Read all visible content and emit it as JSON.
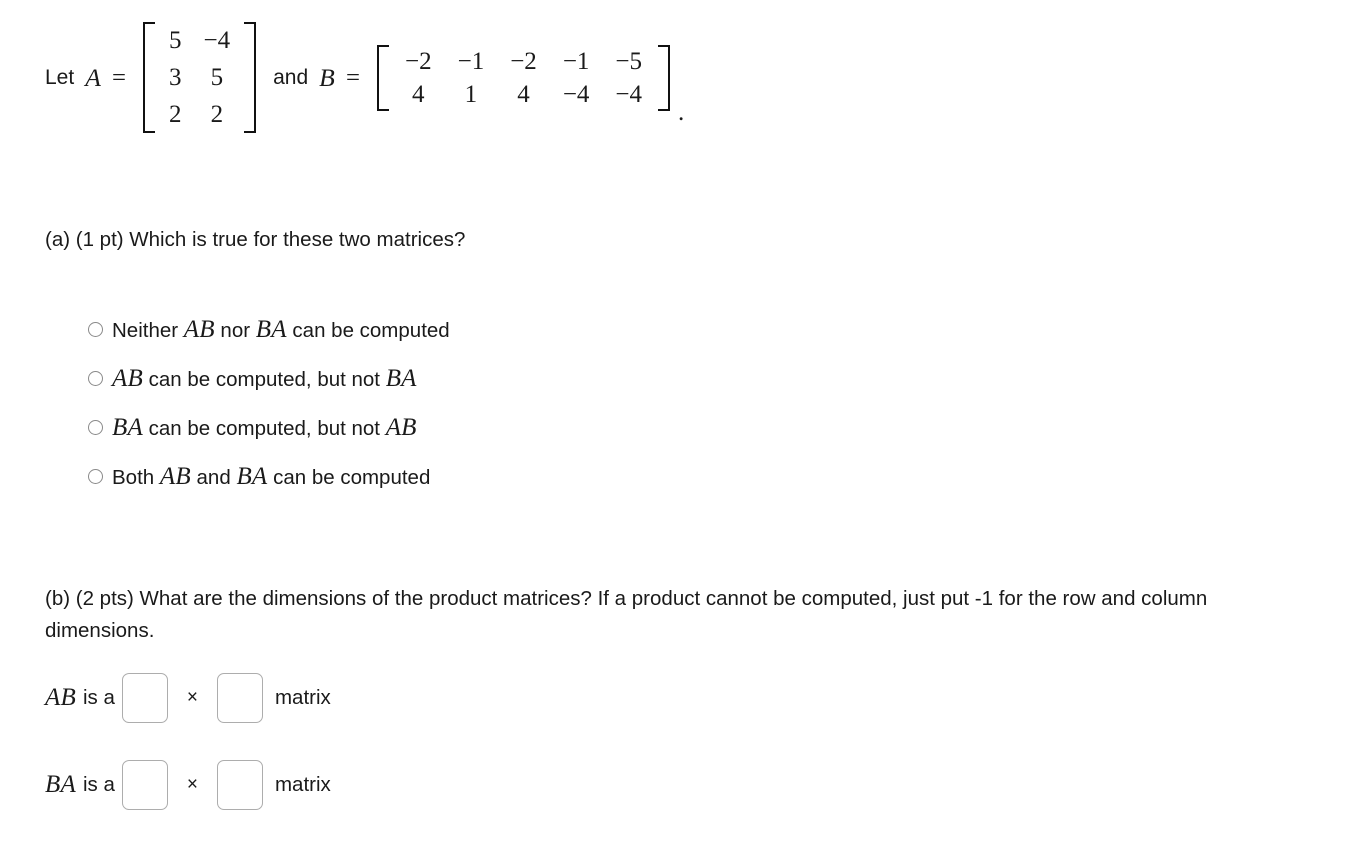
{
  "statement": {
    "lead_text": "Let",
    "var_a": "A",
    "equals": "=",
    "conjunction": "and",
    "var_b": "B",
    "equals_b": "=",
    "period": ".",
    "matrix_a": {
      "name": "A",
      "rows": [
        [
          "5",
          "−4"
        ],
        [
          "3",
          "5"
        ],
        [
          "2",
          "2"
        ]
      ]
    },
    "matrix_b": {
      "name": "B",
      "rows": [
        [
          "−2",
          "−1",
          "−2",
          "−1",
          "−5"
        ],
        [
          "4",
          "1",
          "4",
          "−4",
          "−4"
        ]
      ]
    }
  },
  "part_a": {
    "prompt": "(a) (1 pt) Which is true for these two matrices?",
    "options": [
      {
        "id": "neither",
        "segments": [
          {
            "type": "text",
            "value": "Neither "
          },
          {
            "type": "math",
            "value": "AB"
          },
          {
            "type": "text",
            "value": " nor "
          },
          {
            "type": "math",
            "value": "BA"
          },
          {
            "type": "text",
            "value": " can be computed"
          }
        ],
        "plain": "Neither AB nor BA can be computed",
        "selected": false
      },
      {
        "id": "ab-only",
        "segments": [
          {
            "type": "text",
            "value": " "
          },
          {
            "type": "math",
            "value": "AB"
          },
          {
            "type": "text",
            "value": " can be computed, but not "
          },
          {
            "type": "math",
            "value": "BA"
          }
        ],
        "plain": "AB can be computed, but not BA",
        "selected": false
      },
      {
        "id": "ba-only",
        "segments": [
          {
            "type": "math",
            "value": "BA"
          },
          {
            "type": "text",
            "value": " can be computed, but not "
          },
          {
            "type": "math",
            "value": "AB"
          }
        ],
        "plain": "BA can be computed, but not AB",
        "selected": false
      },
      {
        "id": "both",
        "segments": [
          {
            "type": "text",
            "value": "Both "
          },
          {
            "type": "math",
            "value": "AB"
          },
          {
            "type": "text",
            "value": " and "
          },
          {
            "type": "math",
            "value": "BA"
          },
          {
            "type": "text",
            "value": " can be computed"
          }
        ],
        "plain": "Both AB and BA can be computed",
        "selected": false
      }
    ]
  },
  "part_b": {
    "prompt": "(b) (2 pts) What are the dimensions of the product matrices? If a product cannot be computed, just put -1 for the row and column dimensions.",
    "times_symbol": "×",
    "matrix_word": "matrix",
    "rows": [
      {
        "id": "ab",
        "product": "AB",
        "is_a_text": "is a",
        "row_value": "",
        "col_value": "",
        "row_placeholder": "",
        "col_placeholder": ""
      },
      {
        "id": "ba",
        "product": "BA",
        "is_a_text": "is a",
        "row_value": "",
        "col_value": "",
        "row_placeholder": "",
        "col_placeholder": ""
      }
    ]
  },
  "colors": {
    "background": "#ffffff",
    "text": "#1a1a1a",
    "input_border": "#adadad",
    "radio_border": "#8a8a8a"
  }
}
